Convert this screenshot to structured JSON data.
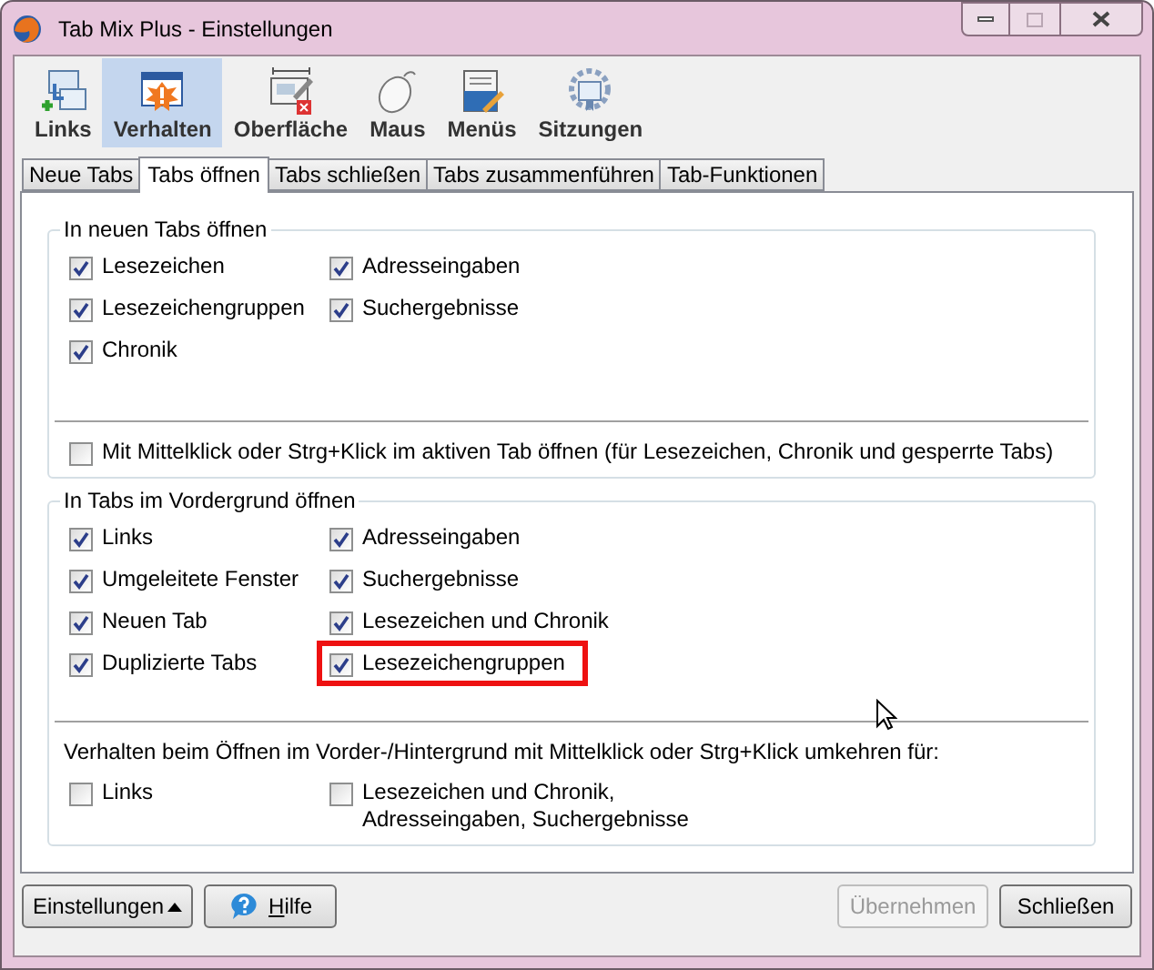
{
  "window": {
    "title": "Tab Mix Plus - Einstellungen"
  },
  "toolbar": [
    {
      "label": "Links",
      "selected": false,
      "kind": "links"
    },
    {
      "label": "Verhalten",
      "selected": true,
      "kind": "behavior"
    },
    {
      "label": "Oberfläche",
      "selected": false,
      "kind": "display"
    },
    {
      "label": "Maus",
      "selected": false,
      "kind": "mouse"
    },
    {
      "label": "Menüs",
      "selected": false,
      "kind": "menus"
    },
    {
      "label": "Sitzungen",
      "selected": false,
      "kind": "sessions"
    }
  ],
  "tabs": [
    {
      "label": "Neue Tabs",
      "selected": false
    },
    {
      "label": "Tabs öffnen",
      "selected": true
    },
    {
      "label": "Tabs schließen",
      "selected": false
    },
    {
      "label": "Tabs zusammenführen",
      "selected": false
    },
    {
      "label": "Tab-Funktionen",
      "selected": false
    }
  ],
  "groups": [
    {
      "title": "In neuen Tabs öffnen",
      "columns": [
        [
          {
            "label": "Lesezeichen",
            "checked": true,
            "highlighted": false
          },
          {
            "label": "Lesezeichengruppen",
            "checked": true,
            "highlighted": false
          },
          {
            "label": "Chronik",
            "checked": true,
            "highlighted": false
          }
        ],
        [
          {
            "label": "Adresseingaben",
            "checked": true,
            "highlighted": false
          },
          {
            "label": "Suchergebnisse",
            "checked": true,
            "highlighted": false
          }
        ]
      ],
      "below": {
        "columns": [
          [
            {
              "label": "Mit Mittelklick oder Strg+Klick im aktiven Tab öffnen (für Lesezeichen, Chronik und gesperrte Tabs)",
              "checked": false
            }
          ]
        ]
      }
    },
    {
      "title": "In Tabs im Vordergrund öffnen",
      "columns": [
        [
          {
            "label": "Links",
            "checked": true,
            "highlighted": false
          },
          {
            "label": "Umgeleitete Fenster",
            "checked": true,
            "highlighted": false
          },
          {
            "label": "Neuen Tab",
            "checked": true,
            "highlighted": false
          },
          {
            "label": "Duplizierte Tabs",
            "checked": true,
            "highlighted": false
          }
        ],
        [
          {
            "label": "Adresseingaben",
            "checked": true,
            "highlighted": false
          },
          {
            "label": "Suchergebnisse",
            "checked": true,
            "highlighted": false
          },
          {
            "label": "Lesezeichen und Chronik",
            "checked": true,
            "highlighted": false
          },
          {
            "label": "Lesezeichengruppen",
            "checked": true,
            "highlighted": true
          }
        ]
      ],
      "below": {
        "heading": "Verhalten beim Öffnen im Vorder-/Hintergrund mit Mittelklick oder Strg+Klick umkehren für:",
        "columns": [
          [
            {
              "label": "Links",
              "checked": false
            }
          ],
          [
            {
              "label": "Lesezeichen und Chronik,\nAdresseingaben, Suchergebnisse",
              "checked": false
            }
          ]
        ]
      }
    }
  ],
  "buttons": [
    {
      "label": "Einstellungen",
      "kind": "menu",
      "disabled": false
    },
    {
      "label": "Hilfe",
      "kind": "help",
      "disabled": false
    },
    {
      "label": "Übernehmen",
      "kind": "plain",
      "disabled": true
    },
    {
      "label": "Schließen",
      "kind": "plain",
      "disabled": false
    }
  ]
}
